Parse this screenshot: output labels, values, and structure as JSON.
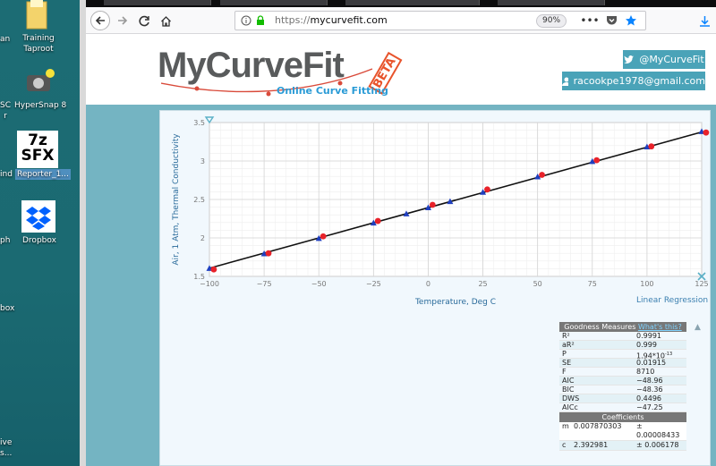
{
  "desktop": {
    "items": [
      {
        "label": "an"
      },
      {
        "label": "Training\nTaproot"
      },
      {
        "label": "HyperSnap 8"
      },
      {
        "label": "SC\nr"
      },
      {
        "label": "7z\nSFX"
      },
      {
        "label": "Reporter_1..."
      },
      {
        "label": "ind"
      },
      {
        "label": "Dropbox"
      },
      {
        "label": "ph"
      },
      {
        "label": "box"
      },
      {
        "label": "ive\ns..."
      }
    ]
  },
  "browser": {
    "url_scheme": "https://",
    "url_host": "mycurvefit.com",
    "zoom": "90%"
  },
  "header": {
    "logo": "MyCurveFit",
    "beta": "BETA",
    "tagline": "Online Curve Fitting",
    "twitter": "@MyCurveFit",
    "email": "racookpe1978@gmail.com"
  },
  "chart_data": {
    "type": "scatter",
    "xlabel": "Temperature, Deg C",
    "ylabel": "Air, 1 Atm, Thermal Conductivity",
    "xlim": [
      -100,
      125
    ],
    "ylim": [
      1.5,
      3.5
    ],
    "xticks": [
      -100,
      -75,
      -50,
      -25,
      0,
      25,
      50,
      75,
      100,
      125
    ],
    "yticks": [
      1.5,
      2,
      2.5,
      3,
      3.5
    ],
    "grid": true,
    "series": [
      {
        "marker": "triangle",
        "color": "#1f3fbf",
        "points": [
          [
            -100,
            1.6
          ],
          [
            -75,
            1.79
          ],
          [
            -50,
            1.99
          ],
          [
            -25,
            2.19
          ],
          [
            -10,
            2.31
          ],
          [
            0,
            2.39
          ],
          [
            10,
            2.47
          ],
          [
            25,
            2.59
          ],
          [
            50,
            2.79
          ],
          [
            75,
            2.99
          ],
          [
            100,
            3.18
          ],
          [
            125,
            3.38
          ]
        ]
      },
      {
        "marker": "circle",
        "color": "#e8222a",
        "points": [
          [
            -98,
            1.59
          ],
          [
            -73,
            1.8
          ],
          [
            -48,
            2.02
          ],
          [
            -23,
            2.22
          ],
          [
            2,
            2.43
          ],
          [
            27,
            2.63
          ],
          [
            52,
            2.82
          ],
          [
            77,
            3.01
          ],
          [
            102,
            3.19
          ],
          [
            127,
            3.37
          ]
        ]
      }
    ],
    "fit_line": {
      "m": 0.007870303,
      "c": 2.392981,
      "color": "#111111"
    }
  },
  "regression_link": "Linear Regression",
  "goodness": {
    "title": "Goodness Measures",
    "link": "What's this?",
    "rows": [
      {
        "k": "R²",
        "v": "0.9991"
      },
      {
        "k": "aR²",
        "v": "0.999"
      },
      {
        "k": "P",
        "v": "1.94*10"
      },
      {
        "k": "SE",
        "v": "0.01915"
      },
      {
        "k": "F",
        "v": "8710"
      },
      {
        "k": "AIC",
        "v": "−48.96"
      },
      {
        "k": "BIC",
        "v": "−48.36"
      },
      {
        "k": "DWS",
        "v": "0.4496"
      },
      {
        "k": "AICc",
        "v": "−47.25"
      }
    ],
    "p_exponent": "-13"
  },
  "coefficients": {
    "title": "Coefficients",
    "rows": [
      {
        "k": "m",
        "v": "0.007870303",
        "err": "± 0.00008433"
      },
      {
        "k": "c",
        "v": "2.392981",
        "err": "± 0.006178"
      }
    ]
  }
}
